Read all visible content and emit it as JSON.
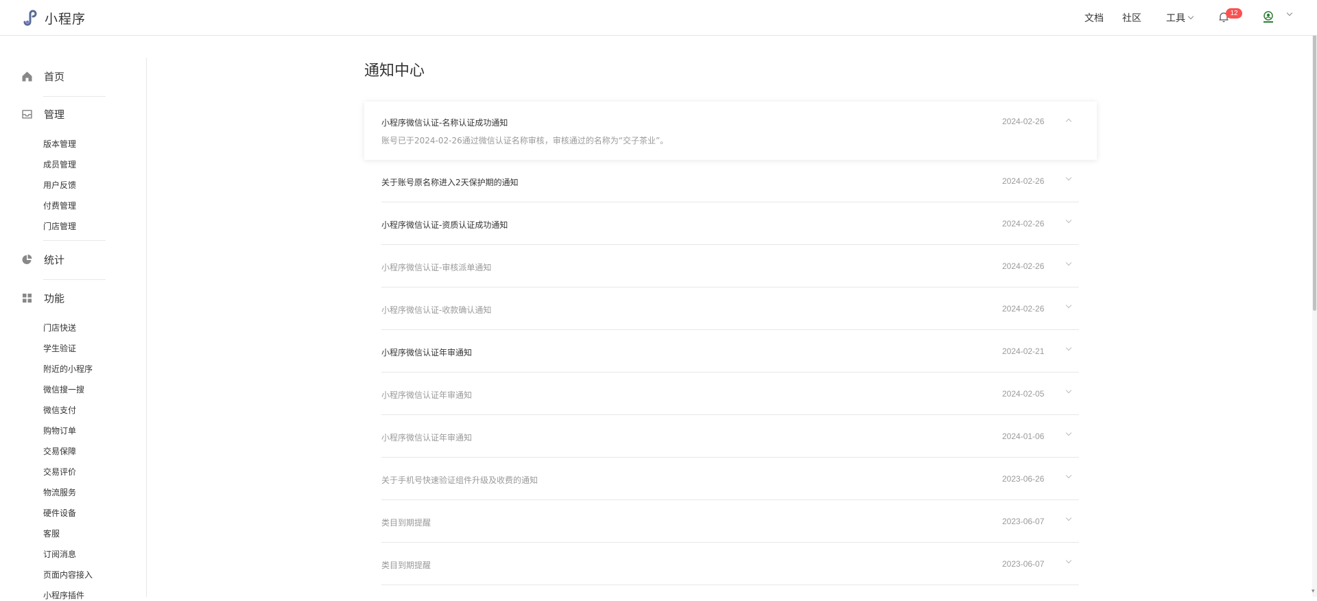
{
  "header": {
    "logo_text": "小程序",
    "nav": {
      "docs": "文档",
      "community": "社区",
      "tools": "工具"
    },
    "notification_count": "12",
    "accent_color": "#576b95"
  },
  "sidebar": {
    "groups": [
      {
        "label": "首页",
        "icon": "home-icon",
        "items": []
      },
      {
        "label": "管理",
        "icon": "inbox-icon",
        "items": [
          "版本管理",
          "成员管理",
          "用户反馈",
          "付费管理",
          "门店管理"
        ]
      },
      {
        "label": "统计",
        "icon": "pie-chart-icon",
        "items": []
      },
      {
        "label": "功能",
        "icon": "grid-icon",
        "items": [
          "门店快送",
          "学生验证",
          "附近的小程序",
          "微信搜一搜",
          "微信支付",
          "购物订单",
          "交易保障",
          "交易评价",
          "物流服务",
          "硬件设备",
          "客服",
          "订阅消息",
          "页面内容接入",
          "小程序插件"
        ]
      }
    ]
  },
  "main": {
    "title": "通知中心",
    "notices": [
      {
        "title": "小程序微信认证-名称认证成功通知",
        "date": "2024-02-26",
        "read": false,
        "expanded": true,
        "body": "账号已于2024-02-26通过微信认证名称审核，审核通过的名称为“交子茶业”。"
      },
      {
        "title": "关于账号原名称进入2天保护期的通知",
        "date": "2024-02-26",
        "read": false
      },
      {
        "title": "小程序微信认证-资质认证成功通知",
        "date": "2024-02-26",
        "read": false
      },
      {
        "title": "小程序微信认证-审核派单通知",
        "date": "2024-02-26",
        "read": true
      },
      {
        "title": "小程序微信认证-收款确认通知",
        "date": "2024-02-26",
        "read": true
      },
      {
        "title": "小程序微信认证年审通知",
        "date": "2024-02-21",
        "read": false
      },
      {
        "title": "小程序微信认证年审通知",
        "date": "2024-02-05",
        "read": true
      },
      {
        "title": "小程序微信认证年审通知",
        "date": "2024-01-06",
        "read": true
      },
      {
        "title": "关于手机号快速验证组件升级及收费的通知",
        "date": "2023-06-26",
        "read": true
      },
      {
        "title": "类目到期提醒",
        "date": "2023-06-07",
        "read": true
      },
      {
        "title": "类目到期提醒",
        "date": "2023-06-07",
        "read": true
      }
    ]
  }
}
